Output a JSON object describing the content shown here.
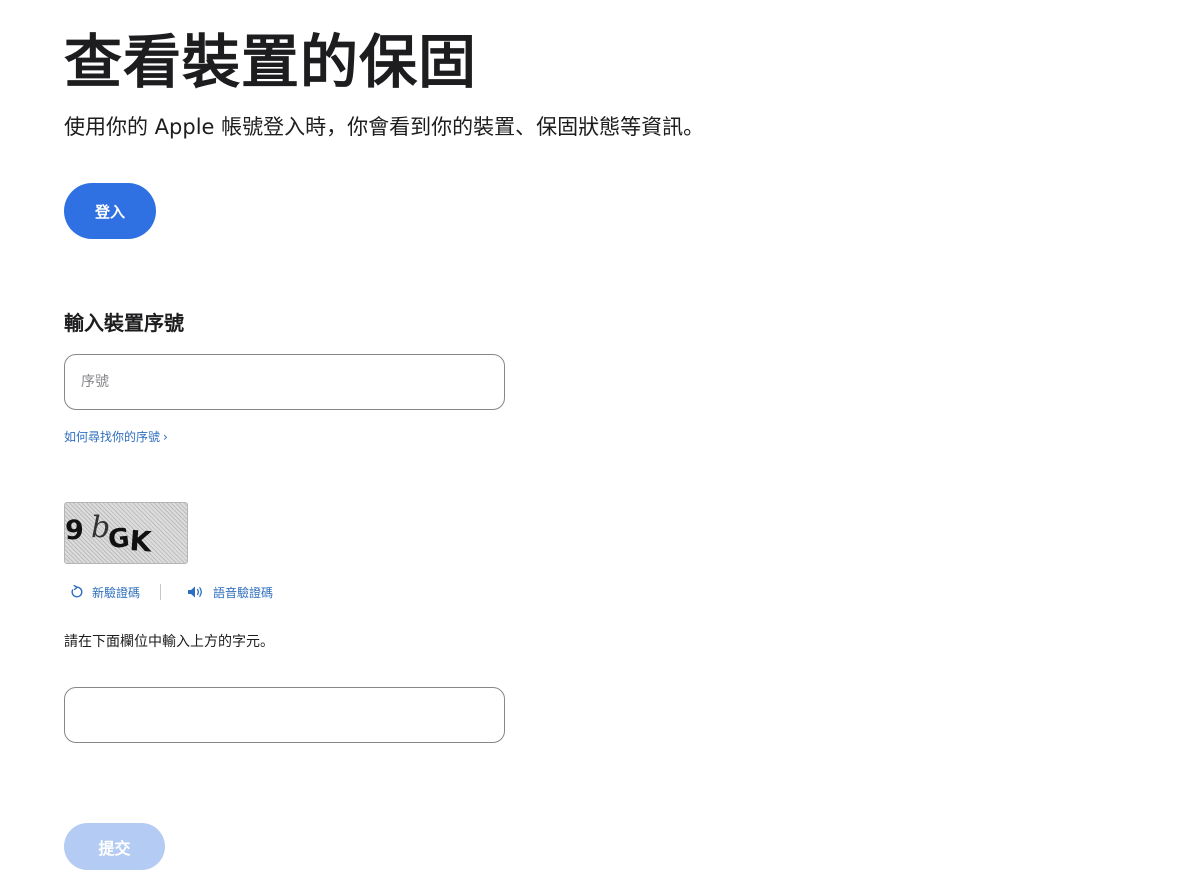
{
  "header": {
    "title": "查看裝置的保固",
    "subtitle": "使用你的 Apple 帳號登入時，你會看到你的裝置、保固狀態等資訊。"
  },
  "sign_in": {
    "label": "登入",
    "color": "#2f71e2"
  },
  "serial_section": {
    "title": "輸入裝置序號",
    "placeholder": "序號",
    "value": "",
    "help_link": "如何尋找你的序號"
  },
  "captcha": {
    "image_text": "9 bGK",
    "new_code_label": "新驗證碼",
    "new_code_icon": "refresh-icon",
    "audio_code_label": "語音驗證碼",
    "audio_code_icon": "speaker-icon",
    "instruction": "請在下面欄位中輸入上方的字元。",
    "answer_value": ""
  },
  "submit": {
    "label": "提交",
    "disabled": true,
    "color": "#b4cbf3"
  },
  "colors": {
    "link": "#2f6fbf",
    "text": "#1d1d1f",
    "border": "#86868b"
  }
}
